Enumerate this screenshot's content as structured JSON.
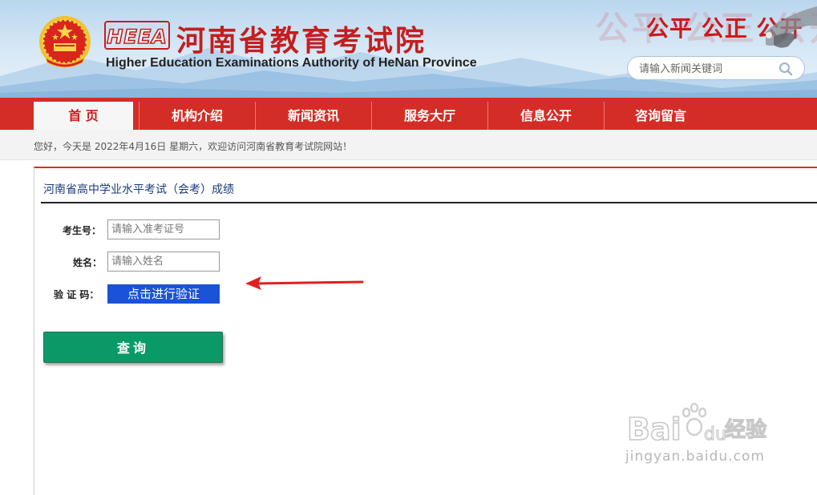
{
  "header": {
    "logo_text": "HEEA",
    "title": "河南省教育考试院",
    "subtitle": "Higher Education Examinations Authority of HeNan Province",
    "slogan": "公平 公正 公开",
    "search": {
      "placeholder": "请输入新闻关键词"
    }
  },
  "nav": {
    "items": [
      {
        "label": "首 页",
        "active": true
      },
      {
        "label": "机构介绍"
      },
      {
        "label": "新闻资讯"
      },
      {
        "label": "服务大厅"
      },
      {
        "label": "信息公开"
      },
      {
        "label": "咨询留言"
      }
    ]
  },
  "welcome": "您好，今天是 2022年4月16日 星期六，欢迎访问河南省教育考试院网站！",
  "panel": {
    "title": "河南省高中学业水平考试（会考）成绩",
    "fields": {
      "exam_no_label": "考生号：",
      "exam_no_placeholder": "请输入准考证号",
      "name_label": "姓名：",
      "name_placeholder": "请输入姓名",
      "captcha_label": "验 证 码：",
      "captcha_button": "点击进行验证"
    },
    "submit": "查询"
  },
  "watermark": {
    "brand": "Bai du 经验",
    "url": "jingyan.baidu.com"
  },
  "colors": {
    "nav_red": "#d42d26",
    "title_red": "#c41e1e",
    "verify_blue": "#1a52d8",
    "query_green": "#0a9a68"
  }
}
